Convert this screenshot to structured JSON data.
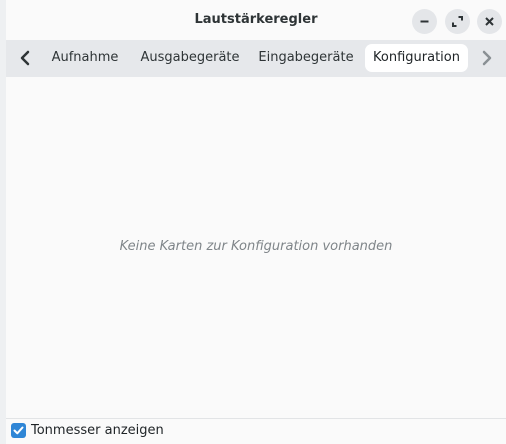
{
  "window": {
    "title": "Lautstärkeregler",
    "controls": {
      "minimize": "minimize-icon",
      "maximize": "maximize-icon",
      "close": "close-icon"
    }
  },
  "tabs": {
    "items": [
      {
        "label": "Aufnahme",
        "active": false
      },
      {
        "label": "Ausgabegeräte",
        "active": false
      },
      {
        "label": "Eingabegeräte",
        "active": false
      },
      {
        "label": "Konfiguration",
        "active": true
      }
    ],
    "prev_icon": "chevron-left-icon",
    "next_icon": "chevron-right-icon"
  },
  "content": {
    "empty_message": "Keine Karten zur Konfiguration vorhanden"
  },
  "footer": {
    "checkbox_label": "Tonmesser anzeigen",
    "checkbox_checked": true
  },
  "colors": {
    "accent": "#2f86d6",
    "tabbar_bg": "#e6e8eb",
    "window_bg": "#fafafa"
  }
}
